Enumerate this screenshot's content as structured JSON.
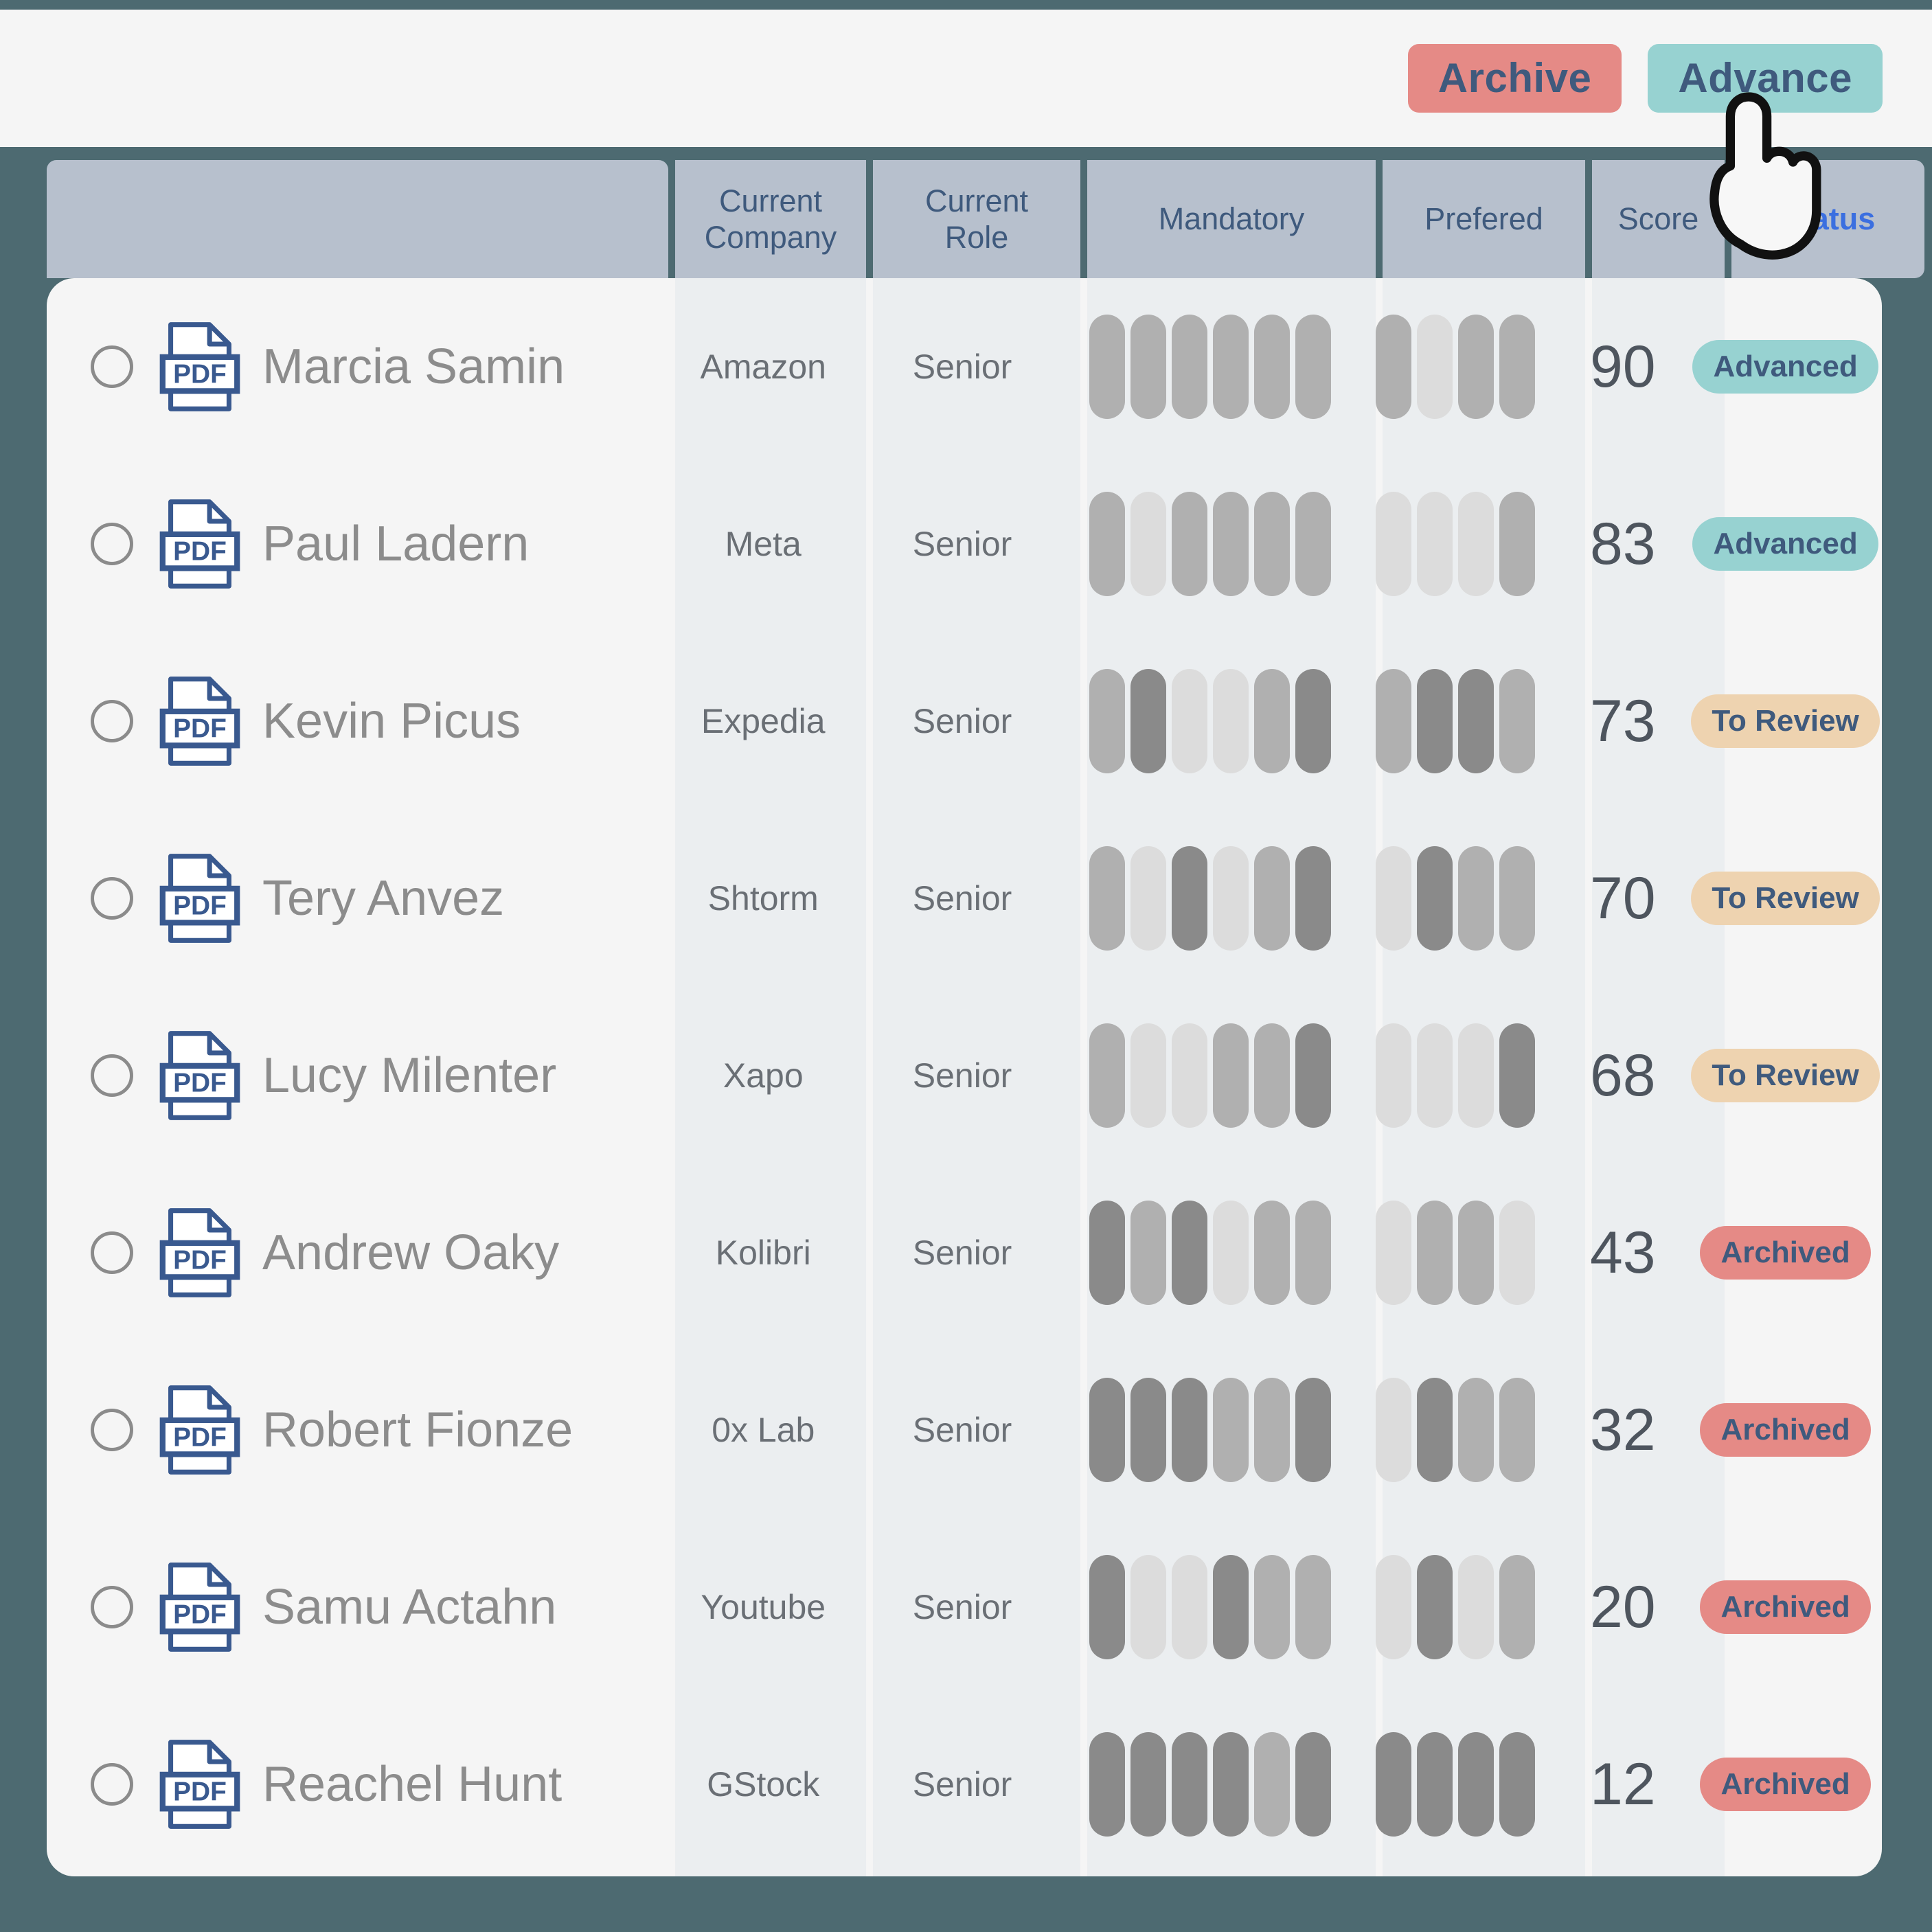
{
  "toolbar": {
    "archive_label": "Archive",
    "advance_label": "Advance",
    "archive_color": "#e58a86",
    "advance_color": "#97d2d1"
  },
  "table": {
    "columns": [
      {
        "key": "name",
        "label": ""
      },
      {
        "key": "company",
        "label": "Current\nCompany"
      },
      {
        "key": "role",
        "label": "Current\nRole"
      },
      {
        "key": "mand",
        "label": "Mandatory"
      },
      {
        "key": "pref",
        "label": "Prefered"
      },
      {
        "key": "score",
        "label": "Score"
      },
      {
        "key": "status",
        "label": "Status"
      }
    ],
    "header_labels": {
      "blank": "",
      "current_company": "Current Company",
      "current_role": "Current Role",
      "mandatory": "Mandatory",
      "prefered": "Prefered",
      "score": "Score",
      "status": "Status"
    },
    "header_status_color": "#3b6fe0",
    "header_bg": "#b7c0cd",
    "file_icon": "pdf-file-icon",
    "file_icon_label": "PDF",
    "bar_colors": {
      "light": "#dcdcdc",
      "medium": "#b0b0b0",
      "dark": "#8a8a8a"
    },
    "status_styles": {
      "Advanced": {
        "bg": "#97d2d1"
      },
      "To Review": {
        "bg": "#eed3b0"
      },
      "Archived": {
        "bg": "#e58a86"
      }
    },
    "rows": [
      {
        "name": "Marcia Samin",
        "company": "Amazon",
        "role": "Senior",
        "score": "90",
        "mandatory": [
          "medium",
          "medium",
          "medium",
          "medium",
          "medium",
          "medium"
        ],
        "preferred": [
          "medium",
          "light",
          "medium",
          "medium"
        ],
        "status": "Advanced"
      },
      {
        "name": "Paul Ladern",
        "company": "Meta",
        "role": "Senior",
        "score": "83",
        "mandatory": [
          "medium",
          "light",
          "medium",
          "medium",
          "medium",
          "medium"
        ],
        "preferred": [
          "light",
          "light",
          "light",
          "medium"
        ],
        "status": "Advanced"
      },
      {
        "name": "Kevin Picus",
        "company": "Expedia",
        "role": "Senior",
        "score": "73",
        "mandatory": [
          "medium",
          "dark",
          "light",
          "light",
          "medium",
          "dark"
        ],
        "preferred": [
          "medium",
          "dark",
          "dark",
          "medium"
        ],
        "status": "To Review"
      },
      {
        "name": "Tery Anvez",
        "company": "Shtorm",
        "role": "Senior",
        "score": "70",
        "mandatory": [
          "medium",
          "light",
          "dark",
          "light",
          "medium",
          "dark"
        ],
        "preferred": [
          "light",
          "dark",
          "medium",
          "medium"
        ],
        "status": "To Review"
      },
      {
        "name": "Lucy Milenter",
        "company": "Xapo",
        "role": "Senior",
        "score": "68",
        "mandatory": [
          "medium",
          "light",
          "light",
          "medium",
          "medium",
          "dark"
        ],
        "preferred": [
          "light",
          "light",
          "light",
          "dark"
        ],
        "status": "To Review"
      },
      {
        "name": "Andrew Oaky",
        "company": "Kolibri",
        "role": "Senior",
        "score": "43",
        "mandatory": [
          "dark",
          "medium",
          "dark",
          "light",
          "medium",
          "medium"
        ],
        "preferred": [
          "light",
          "medium",
          "medium",
          "light"
        ],
        "status": "Archived"
      },
      {
        "name": "Robert Fionze",
        "company": "0x Lab",
        "role": "Senior",
        "score": "32",
        "mandatory": [
          "dark",
          "dark",
          "dark",
          "medium",
          "medium",
          "dark"
        ],
        "preferred": [
          "light",
          "dark",
          "medium",
          "medium"
        ],
        "status": "Archived"
      },
      {
        "name": "Samu Actahn",
        "company": "Youtube",
        "role": "Senior",
        "score": "20",
        "mandatory": [
          "dark",
          "light",
          "light",
          "dark",
          "medium",
          "medium"
        ],
        "preferred": [
          "light",
          "dark",
          "light",
          "medium"
        ],
        "status": "Archived"
      },
      {
        "name": "Reachel Hunt",
        "company": "GStock",
        "role": "Senior",
        "score": "12",
        "mandatory": [
          "dark",
          "dark",
          "dark",
          "dark",
          "medium",
          "dark"
        ],
        "preferred": [
          "dark",
          "dark",
          "dark",
          "dark"
        ],
        "status": "Archived"
      }
    ]
  },
  "cursor": {
    "icon": "hand-pointer-cursor"
  },
  "theme": {
    "page_bg": "#4d6a71",
    "panel_bg": "#f5f5f5",
    "column_tint": "#ebeef0"
  }
}
